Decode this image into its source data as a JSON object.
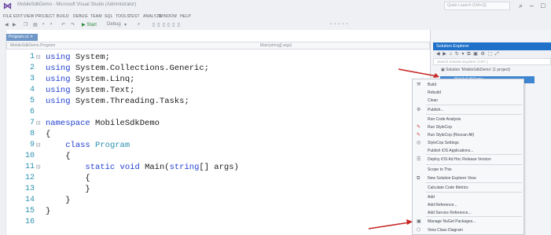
{
  "window": {
    "title": "MobileSdkDemo - Microsoft Visual Studio (Administrator)",
    "quick_launch_placeholder": "Quick Launch (Ctrl+Q)",
    "controls": [
      "–",
      "□",
      "✕"
    ]
  },
  "menu": [
    "FILE",
    "EDIT",
    "VIEW",
    "PROJECT",
    "BUILD",
    "DEBUG",
    "TEAM",
    "SQL",
    "TOOLS",
    "TEST",
    "ANALYZE",
    "WINDOW",
    "HELP"
  ],
  "toolbar": {
    "start_label": "▶ Start",
    "config_label": "Debug"
  },
  "editor": {
    "tab_label": "Program.cs",
    "nav_left": "MobileSdkDemo.Program",
    "nav_right": "Main(string[] args)",
    "lines": [
      {
        "num": "1",
        "fold": "⊟",
        "parts": [
          {
            "t": "using",
            "c": "kw"
          },
          {
            "t": " System;",
            "c": ""
          }
        ]
      },
      {
        "num": "2",
        "fold": "",
        "parts": [
          {
            "t": "using",
            "c": "kw"
          },
          {
            "t": " System.Collections.Generic;",
            "c": ""
          }
        ]
      },
      {
        "num": "3",
        "fold": "",
        "parts": [
          {
            "t": "using",
            "c": "kw"
          },
          {
            "t": " System.Linq;",
            "c": ""
          }
        ]
      },
      {
        "num": "4",
        "fold": "",
        "parts": [
          {
            "t": "using",
            "c": "kw"
          },
          {
            "t": " System.Text;",
            "c": ""
          }
        ]
      },
      {
        "num": "5",
        "fold": "",
        "parts": [
          {
            "t": "using",
            "c": "kw"
          },
          {
            "t": " System.Threading.Tasks;",
            "c": ""
          }
        ]
      },
      {
        "num": "6",
        "fold": "",
        "parts": []
      },
      {
        "num": "7",
        "fold": "⊟",
        "parts": [
          {
            "t": "namespace",
            "c": "kw"
          },
          {
            "t": " MobileSdkDemo",
            "c": ""
          }
        ]
      },
      {
        "num": "8",
        "fold": "",
        "parts": [
          {
            "t": "{",
            "c": ""
          }
        ]
      },
      {
        "num": "9",
        "fold": "⊟",
        "parts": [
          {
            "t": "    ",
            "c": ""
          },
          {
            "t": "class",
            "c": "kw"
          },
          {
            "t": " ",
            "c": ""
          },
          {
            "t": "Program",
            "c": "ty"
          }
        ]
      },
      {
        "num": "10",
        "fold": "",
        "parts": [
          {
            "t": "    {",
            "c": ""
          }
        ]
      },
      {
        "num": "11",
        "fold": "⊟",
        "parts": [
          {
            "t": "        ",
            "c": ""
          },
          {
            "t": "static",
            "c": "kw"
          },
          {
            "t": " ",
            "c": ""
          },
          {
            "t": "void",
            "c": "kw"
          },
          {
            "t": " Main(",
            "c": ""
          },
          {
            "t": "string",
            "c": "kw"
          },
          {
            "t": "[] args)",
            "c": ""
          }
        ]
      },
      {
        "num": "12",
        "fold": "",
        "parts": [
          {
            "t": "        {",
            "c": ""
          }
        ]
      },
      {
        "num": "13",
        "fold": "",
        "parts": [
          {
            "t": "        }",
            "c": ""
          }
        ]
      },
      {
        "num": "14",
        "fold": "",
        "parts": [
          {
            "t": "    }",
            "c": ""
          }
        ]
      },
      {
        "num": "15",
        "fold": "",
        "parts": [
          {
            "t": "}",
            "c": ""
          }
        ]
      },
      {
        "num": "16",
        "fold": "",
        "parts": []
      }
    ]
  },
  "solution_explorer": {
    "title": "Solution Explorer",
    "search_placeholder": "Search Solution Explorer (Ctrl+;)",
    "solution_node": "Solution 'MobileSdkDemo' (1 project)",
    "project_node": "MobileSdkDemo"
  },
  "context_menu": {
    "items": [
      {
        "label": "Build",
        "icon": "⚒",
        "icon_name": "build-icon",
        "red": false
      },
      {
        "label": "Rebuild",
        "icon": "",
        "icon_name": "",
        "red": false
      },
      {
        "label": "Clean",
        "icon": "",
        "icon_name": "",
        "red": false
      },
      {
        "label": "Publish...",
        "icon": "⚙",
        "icon_name": "publish-icon",
        "red": false
      },
      {
        "label": "Run Code Analysis",
        "icon": "",
        "icon_name": "",
        "red": false
      },
      {
        "label": "Run StyleCop",
        "icon": "✎",
        "icon_name": "stylecop-icon",
        "red": true
      },
      {
        "label": "Run StyleCop (Rescan All)",
        "icon": "✎",
        "icon_name": "stylecop-rescan-icon",
        "red": true
      },
      {
        "label": "StyleCop Settings",
        "icon": "◎",
        "icon_name": "settings-icon",
        "red": false
      },
      {
        "label": "Publish iOS Applications...",
        "icon": "",
        "icon_name": "",
        "red": false
      },
      {
        "label": "Deploy iOS Ad Hoc Release Version",
        "icon": "☰",
        "icon_name": "deploy-icon",
        "red": false
      },
      {
        "label": "Scope to This",
        "icon": "",
        "icon_name": "",
        "red": false
      },
      {
        "label": "New Solution Explorer View",
        "icon": "⧉",
        "icon_name": "new-view-icon",
        "red": false
      },
      {
        "label": "Calculate Code Metrics",
        "icon": "",
        "icon_name": "",
        "red": false
      },
      {
        "label": "Add",
        "icon": "",
        "icon_name": "",
        "red": false
      },
      {
        "label": "Add Reference...",
        "icon": "",
        "icon_name": "",
        "red": false
      },
      {
        "label": "Add Service Reference...",
        "icon": "",
        "icon_name": "",
        "red": false
      },
      {
        "label": "Manage NuGet Packages...",
        "icon": "▣",
        "icon_name": "nuget-icon",
        "red": false
      },
      {
        "label": "View Class Diagram",
        "icon": "⬡",
        "icon_name": "class-diagram-icon",
        "red": false
      }
    ]
  },
  "colors": {
    "accent": "#1e70c9",
    "keyword": "#1f3fcf",
    "type": "#2b91af",
    "line_number": "#2b91af",
    "arrow": "#c62828"
  }
}
